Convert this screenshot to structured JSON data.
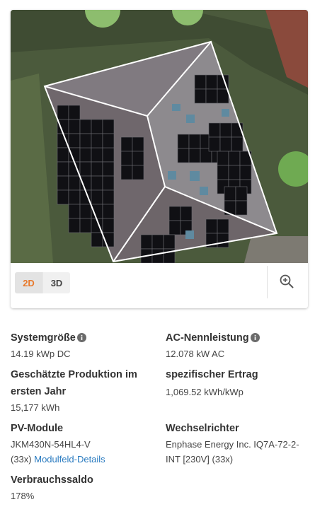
{
  "view_toggle": {
    "mode_2d": "2D",
    "mode_3d": "3D",
    "active": "2D"
  },
  "colors": {
    "accent": "#e8792b",
    "link": "#2a7bc0",
    "panel": "#101014"
  },
  "icons": {
    "zoom": "zoom-in-icon",
    "info": "info-icon"
  },
  "specs": {
    "system_size": {
      "label": "Systemgröße",
      "value": "14.19 kWp DC"
    },
    "ac_power": {
      "label": "AC-Nennleistung",
      "value": "12.078 kW AC"
    },
    "production": {
      "label_line1": "Geschätzte Produktion im",
      "label_line2": "ersten Jahr",
      "value": "15,177 kWh"
    },
    "specific_yield": {
      "label": "spezifischer Ertrag",
      "value": "1,069.52 kWh/kWp"
    },
    "pv_modules": {
      "label": "PV-Module",
      "model": "JKM430N-54HL4-V",
      "count": "(33x)",
      "link": "Modulfeld-Details"
    },
    "inverter": {
      "label": "Wechselrichter",
      "value_line1": "Enphase Energy Inc. IQ7A-72-2-",
      "value_line2": "INT [230V] (33x)"
    },
    "consumption_balance": {
      "label": "Verbrauchssaldo",
      "value": "178%"
    }
  }
}
